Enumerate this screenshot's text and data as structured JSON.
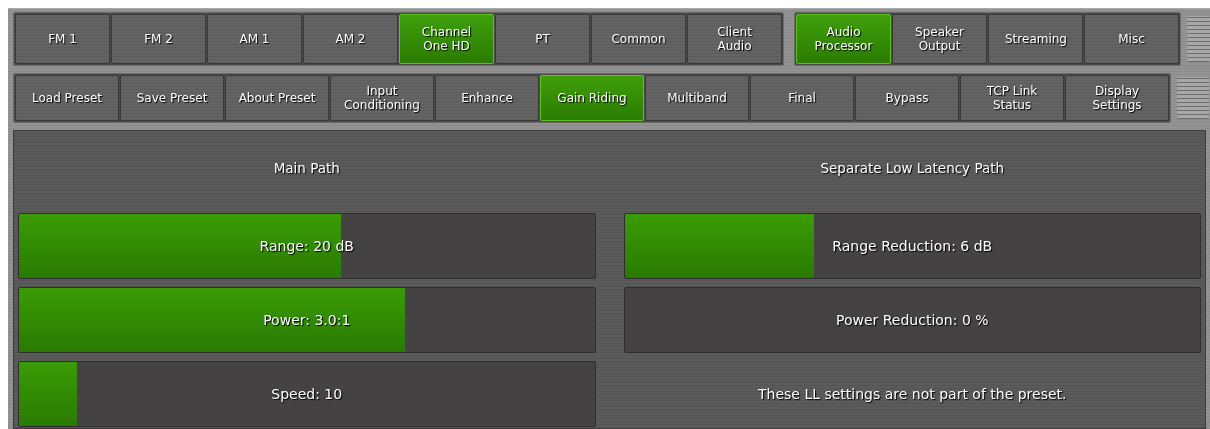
{
  "top_tab_groups": [
    {
      "tabs": [
        {
          "label": "FM 1",
          "selected": false
        },
        {
          "label": "FM 2",
          "selected": false
        },
        {
          "label": "AM 1",
          "selected": false
        },
        {
          "label": "AM 2",
          "selected": false
        },
        {
          "label": "Channel One HD",
          "selected": true
        },
        {
          "label": "PT",
          "selected": false
        },
        {
          "label": "Common",
          "selected": false
        },
        {
          "label": "Client Audio",
          "selected": false
        }
      ]
    },
    {
      "tabs": [
        {
          "label": "Audio Processor",
          "selected": true
        },
        {
          "label": "Speaker Output",
          "selected": false
        },
        {
          "label": "Streaming",
          "selected": false
        },
        {
          "label": "Misc",
          "selected": false
        }
      ]
    }
  ],
  "sub_tabs": [
    {
      "label": "Load Preset",
      "selected": false
    },
    {
      "label": "Save Preset",
      "selected": false
    },
    {
      "label": "About Preset",
      "selected": false
    },
    {
      "label": "Input Conditioning",
      "selected": false
    },
    {
      "label": "Enhance",
      "selected": false
    },
    {
      "label": "Gain Riding",
      "selected": true
    },
    {
      "label": "Multiband",
      "selected": false
    },
    {
      "label": "Final",
      "selected": false
    },
    {
      "label": "Bypass",
      "selected": false
    },
    {
      "label": "TCP Link Status",
      "selected": false
    },
    {
      "label": "Display Settings",
      "selected": false
    }
  ],
  "main_path": {
    "title": "Main Path",
    "sliders": [
      {
        "label": "Range: 20 dB",
        "level": 0.56
      },
      {
        "label": "Power: 3.0:1",
        "level": 0.67
      },
      {
        "label": "Speed: 10",
        "level": 0.1
      }
    ]
  },
  "low_latency_path": {
    "title": "Separate Low Latency Path",
    "sliders": [
      {
        "label": "Range Reduction: 6 dB",
        "level": 0.33
      },
      {
        "label": "Power Reduction: 0 %"
      }
    ],
    "note": "These LL settings are not part of the preset."
  }
}
